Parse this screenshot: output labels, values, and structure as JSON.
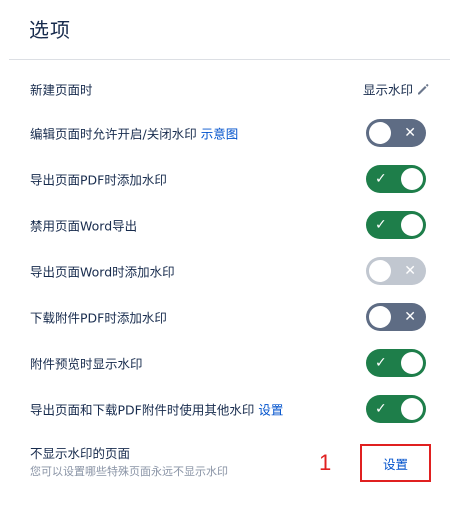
{
  "page": {
    "title": "选项"
  },
  "rows": [
    {
      "label": "新建页面时",
      "value": "显示水印"
    },
    {
      "label": "编辑页面时允许开启/关闭水印",
      "link": "示意图",
      "toggle": "off"
    },
    {
      "label": "导出页面PDF时添加水印",
      "toggle": "on"
    },
    {
      "label": "禁用页面Word导出",
      "toggle": "on"
    },
    {
      "label": "导出页面Word时添加水印",
      "toggle": "disabled"
    },
    {
      "label": "下载附件PDF时添加水印",
      "toggle": "off"
    },
    {
      "label": "附件预览时显示水印",
      "toggle": "on"
    },
    {
      "label": "导出页面和下载PDF附件时使用其他水印",
      "link": "设置",
      "toggle": "on"
    }
  ],
  "no_watermark": {
    "label": "不显示水印的页面",
    "description": "您可以设置哪些特殊页面永远不显示水印",
    "button_label": "设置"
  },
  "annotation": {
    "number": "1"
  },
  "glyphs": {
    "check": "✓",
    "cross": "✕"
  },
  "colors": {
    "toggle_on": "#1e7e4a",
    "toggle_off": "#5e6c84",
    "toggle_disabled": "#c1c7d0",
    "link": "#0052cc",
    "annotation": "#e02020"
  }
}
